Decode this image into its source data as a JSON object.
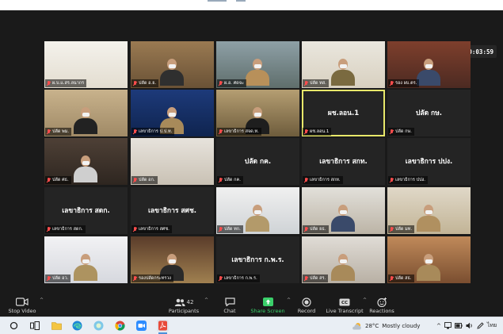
{
  "recording": {
    "time": "00:03:59"
  },
  "tiles": [
    {
      "label": "ผ.บ.แ.สร.ลนากร"
    },
    {
      "label": "ปลัด อ.ย."
    },
    {
      "label": "ผ.อ. ศดจะ"
    },
    {
      "label": "ปลัด ทส."
    },
    {
      "label": "รอง ผบ.ตร."
    },
    {
      "label": "ปลัด พม."
    },
    {
      "label": "เลขาธิการ ป.ป.ท."
    },
    {
      "label": "เลขาธิการ สจด.ท."
    },
    {
      "label": "ผช.ลอน.1",
      "big": "ผช.ลอน.1"
    },
    {
      "label": "ปลัด กษ.",
      "big": "ปลัด กษ."
    },
    {
      "label": "ปลัด ศธ."
    },
    {
      "label": "ปลัด อก."
    },
    {
      "label": "ปลัด กค.",
      "big": "ปลัด กค."
    },
    {
      "label": "เลขาธิการ สกท.",
      "big": "เลขาธิการ สกท."
    },
    {
      "label": "เลขาธิการ ปปง.",
      "big": "เลขาธิการ ปปง."
    },
    {
      "label": "เลขาธิการ สดก.",
      "big": "เลขาธิการ สดก."
    },
    {
      "label": "เลขาธิการ สศช.",
      "big": "เลขาธิการ สศช."
    },
    {
      "label": "ปลัด ทก."
    },
    {
      "label": "ปลัด ยธ."
    },
    {
      "label": "ปลัด มท."
    },
    {
      "label": "ปลัด อว."
    },
    {
      "label": "รองปลัดกระทรวง"
    },
    {
      "label": "เลขาธิการ ก.พ.ร.",
      "big": "เลขาธิการ ก.พ.ร."
    },
    {
      "label": "ปลัด สร."
    },
    {
      "label": "ปลัด สธ."
    }
  ],
  "toolbar": {
    "stop_video": "Stop Video",
    "participants": "Participants",
    "participants_count": "42",
    "chat": "Chat",
    "share_screen": "Share Screen",
    "record": "Record",
    "live_transcript": "Live Transcript",
    "reactions": "Reactions"
  },
  "taskbar": {
    "weather": "28°C",
    "weather_text": "Mostly cloudy",
    "lang": "ไทย"
  },
  "colors": {
    "active_speaker": "#e8e86a",
    "share_green": "#3ad06a",
    "mute_red": "#ff4d4d",
    "rec_red": "#e02020"
  }
}
